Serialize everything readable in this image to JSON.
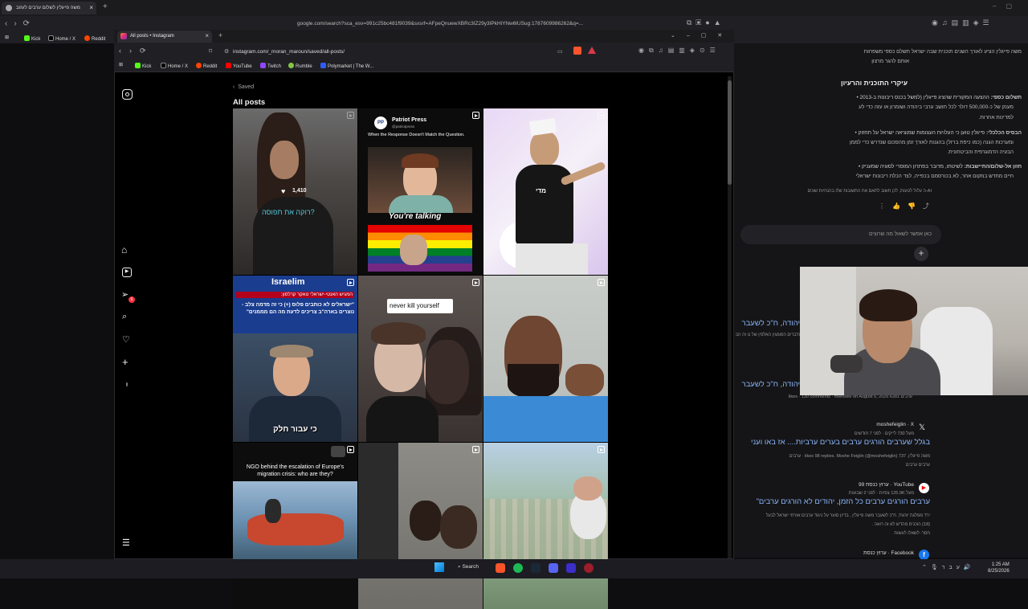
{
  "bg_browser": {
    "tab_title": "משה פייגלין לשלום ערבים לעזוב",
    "url": "google.com/search?sca_esv=991c25bc481f9039&sxsrf=AFpeQnuewXBRc3IZ29y3IPkHiYNw6lUSug:1787609986262&q=...",
    "url_query": "משה+פייגלין+לשלום+ערבים",
    "bookmarks": [
      "Kick",
      "Home / X",
      "Reddit"
    ]
  },
  "google": {
    "intro_text": "משה פייגלין הציע לאורך השנים תוכנית שבה ישראל תשלם כספי משפחות",
    "intro_text2": "אותם להגר מרצון",
    "heading": "עיקרי התוכנית והרעיון",
    "bullet1_title": "תשלום כספי:",
    "bullet1_text": "ההצעה המקורית שהציג פייגלין (למשל בכנס ריבונות ב-2013",
    "bullet1_line2": "מענק של כ-500,000 דולר לכל תושב ערבי ביהודה ושומרון או עזה כדי לע",
    "bullet1_line3": "למדינות אחרות.",
    "bullet2_title": "הבסיס הכלכלי:",
    "bullet2_text": "פייגלין טוען כי העלויות העצומות שמוציאה ישראל על תחזוק",
    "bullet2_line2": "ומערכות הגנה (כמו כיפת ברזל) בהגנות לאורך זמן מהסכום שנדרש כדי לממן",
    "bullet2_line3": "הבעיה הדמוגרפית והביטחונית.",
    "bullet3_title": "חזון אל-שלום/התיישבות:",
    "bullet3_text": "לשיטתו, מדובר בפתרון המוסרי לסוגיה שמעניק",
    "bullet3_line2": "חיים מחדש במקום אחר, לא בכורסמם בכפייה, לצד הכלת ריבונות ישראלי",
    "disclaimer": "AI-ה עלול לטעות, לכן חשוב לתאם את התשובות שלו בהנחיות שונים",
    "ask_placeholder": "כאן אפשר לשאול מה שרוצים",
    "result1_title": "יהודה, ח\"כ לשעבר",
    "result1_snippet": "ודברים הפומגין האלפין של נו זה הנאה",
    "result2_title": "יהודה, ח\"כ לשעבר",
    "result2_snippet": "ערבים 6281 likes · 130 comments · mkessev on August 5, 2026",
    "x_source": "moshefeiglin · X",
    "x_meta": "מעל 730 לייקים · לפני 7 חודשים",
    "x_title": "בגלל שערבים הורגים ערבים בערים ערביות.... אז באו ועני",
    "x_snippet": "משה פייגלין. 737 likes 98 replies. Moshe Feiglin (@moshefeiglin) · ערבים",
    "x_snippet2": "ערבים ערבים",
    "yt_source": "YouTube · ערוץ כנסת 99",
    "yt_meta": "מעל 125.9K צפיות · לפני 2 שבועות",
    "yt_title": "ערבים הורגים ערבים כל הזמן, יהודים לא הורגים ערבים\"",
    "yt_snippet": "ירד מפלגת 'זהות', ח\"כ לשעבר משה פייגלין , בדיון סוער על ניגוד ערבים אזרחי ישראל לבעל",
    "yt_snippet2": "(18) הוכניס מהדש לא זה רואה .",
    "yt_snippet3": "חסר: לשאלו לעשות",
    "fb_source": "Facebook · ערוץ כנסת"
  },
  "ig_browser": {
    "tab_title": "All posts • Instagram",
    "url": "instagram.com/_moran_maroun/saved/all-posts/",
    "bookmarks": [
      "Kick",
      "Home / X",
      "Reddit",
      "YouTube",
      "Twitch",
      "Rumble",
      "Polymarket | The W..."
    ]
  },
  "instagram": {
    "back_label": "Saved",
    "title": "All posts",
    "notif_count": "6",
    "posts": [
      {
        "caption": "?רוקה את תפוסה",
        "likes": "1,410",
        "likes_icon": "heart-icon"
      },
      {
        "account": "Patriot Press",
        "handle": "@patriotpress",
        "headline": "When the Response Doesn't Match the Question.",
        "overlay": "You're talking"
      },
      {
        "tag": "מדי"
      },
      {
        "brand": "Israelim",
        "headline_he": "המגיש האנטי-ישראלי טאקר קרלסון:",
        "quote_he": "\"ישראלים לא כותבים פלוס (+) כי זה מדמה צלב - נוצרים בארה\"ב צריכים לדעת מה הם מממנים\"",
        "caption_he": "כי עבור חלק"
      },
      {
        "overlay": "never kill yourself"
      },
      {},
      {
        "headline": "NGO behind the escalation of Europe's migration crisis: who are they?"
      },
      {},
      {}
    ]
  },
  "taskbar": {
    "search_label": "Search",
    "time": "1:25 AM",
    "date": "8/25/2026",
    "lang": "עבר"
  },
  "colors": {
    "accent_blue": "#8ab4f8",
    "ig_bg": "#000000",
    "notif_red": "#ff3040",
    "israelim_blue": "#1a3d8f"
  }
}
